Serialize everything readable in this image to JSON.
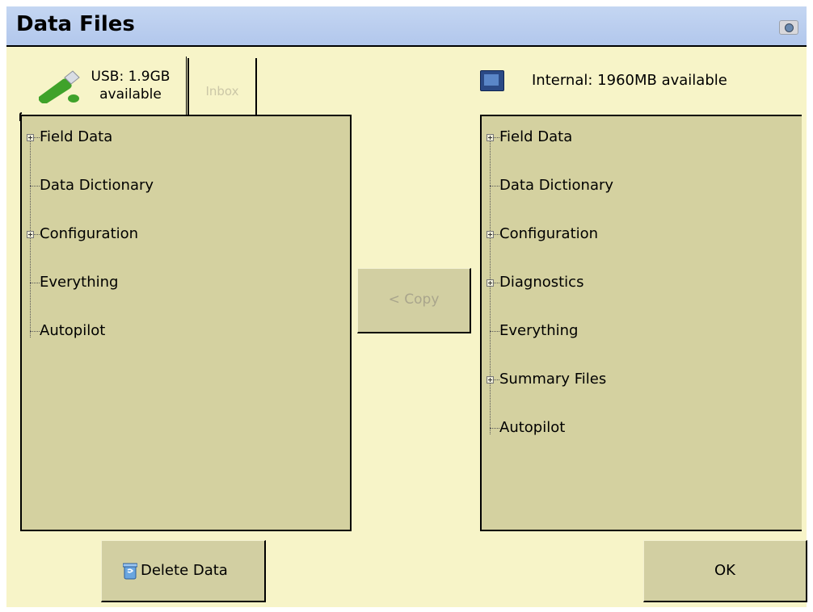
{
  "window": {
    "title": "Data Files",
    "camera_icon": "camera-icon"
  },
  "usb": {
    "label_line1": "USB: 1.9GB",
    "label_line2": "available",
    "icon": "usb-stick-icon",
    "inbox_tab_label": "Inbox"
  },
  "left_tree": {
    "items": [
      {
        "label": "Field Data",
        "expandable": true
      },
      {
        "label": "Data Dictionary",
        "expandable": false
      },
      {
        "label": "Configuration",
        "expandable": true
      },
      {
        "label": "Everything",
        "expandable": false
      },
      {
        "label": "Autopilot",
        "expandable": false
      }
    ]
  },
  "copy_button": {
    "label": "< Copy",
    "enabled": false
  },
  "internal": {
    "label": "Internal: 1960MB available",
    "icon": "display-unit-icon"
  },
  "right_tree": {
    "items": [
      {
        "label": "Field Data",
        "expandable": true
      },
      {
        "label": "Data Dictionary",
        "expandable": false
      },
      {
        "label": "Configuration",
        "expandable": true
      },
      {
        "label": "Diagnostics",
        "expandable": true
      },
      {
        "label": "Everything",
        "expandable": false
      },
      {
        "label": "Summary Files",
        "expandable": true
      },
      {
        "label": "Autopilot",
        "expandable": false
      }
    ]
  },
  "buttons": {
    "delete_label": "Delete Data",
    "ok_label": "OK"
  },
  "colors": {
    "background": "#f7f4c8",
    "panel": "#d4d1a0",
    "titlebar": "#b8cbee"
  }
}
